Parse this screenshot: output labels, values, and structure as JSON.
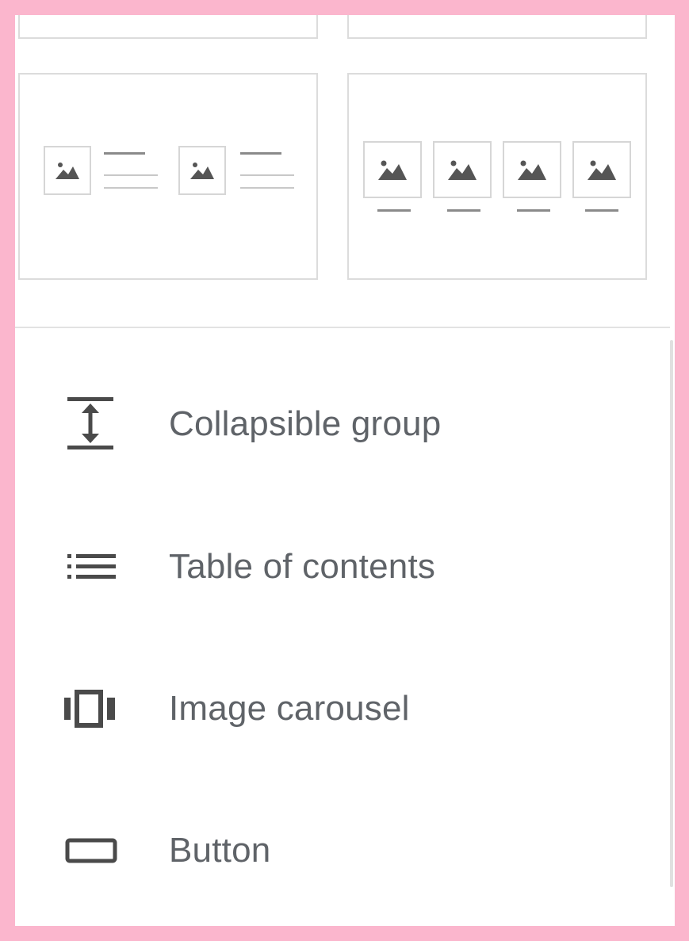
{
  "colors": {
    "page_border": "#fbb6cd",
    "panel_background": "#ffffff",
    "icon_color": "#5f6368",
    "label_color": "#5f6368",
    "card_border": "#dcdcdc"
  },
  "layout_cards": [
    {
      "name": "two-images-with-text",
      "icons": [
        "image-placeholder-icon",
        "image-placeholder-icon"
      ]
    },
    {
      "name": "four-images-with-captions",
      "icons": [
        "image-placeholder-icon",
        "image-placeholder-icon",
        "image-placeholder-icon",
        "image-placeholder-icon"
      ]
    }
  ],
  "menu": {
    "items": [
      {
        "label": "Collapsible group",
        "icon": "collapsible-group-icon"
      },
      {
        "label": "Table of contents",
        "icon": "table-of-contents-icon"
      },
      {
        "label": "Image carousel",
        "icon": "image-carousel-icon"
      },
      {
        "label": "Button",
        "icon": "button-icon"
      }
    ]
  }
}
